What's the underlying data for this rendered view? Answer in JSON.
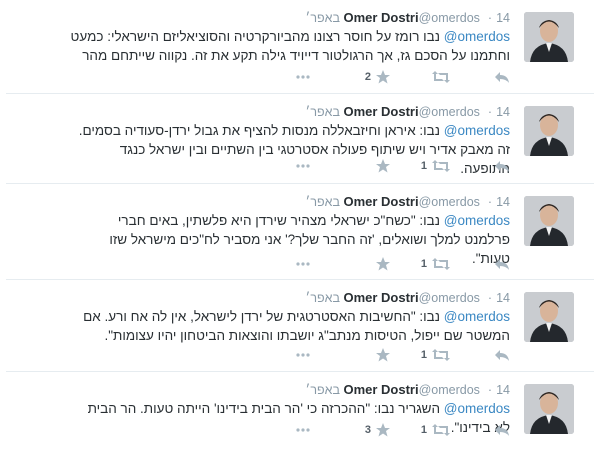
{
  "colors": {
    "mention": "#3b88c3",
    "muted": "#8899a6",
    "text": "#292f33",
    "divider": "#e6ecf0"
  },
  "tweets": [
    {
      "name": "Omer Dostri",
      "handle": "@omerdos",
      "date": "14 באפר׳",
      "mention": "@omerdos",
      "text": " נבו רומז על חוסר רצונו מהביורקרטיה והסוציאליזם הישראלי: כמעט וחתמנו על הסכם גז, אך הרגולטור דייויד גילה תקע את זה. נקווה שייתחם מהר",
      "reply_count": "",
      "retweet_count": "",
      "favorite_count": "2"
    },
    {
      "name": "Omer Dostri",
      "handle": "@omerdos",
      "date": "14 באפר׳",
      "mention": "@omerdos",
      "text": " נבו: איראן וחיזבאללה מנסות להציף את גבול ירדן-סעודיה בסמים. זה מאבק אדיר ויש שיתוף פעולה אסטרטגי בין השתיים ובין ישראל כנגד התופעה.",
      "reply_count": "",
      "retweet_count": "1",
      "favorite_count": ""
    },
    {
      "name": "Omer Dostri",
      "handle": "@omerdos",
      "date": "14 באפר׳",
      "mention": "@omerdos",
      "text": " נבו: \"כשח\"כ ישראלי מצהיר שירדן היא פלשתין, באים חברי פרלמנט למלך ושואלים, 'זה החבר שלך?' אני מסביר לח\"כים מישראל שזו טעות\".",
      "reply_count": "",
      "retweet_count": "1",
      "favorite_count": ""
    },
    {
      "name": "Omer Dostri",
      "handle": "@omerdos",
      "date": "14 באפר׳",
      "mention": "@omerdos",
      "text": " נבו: \"החשיבות האסטרטגית של ירדן לישראל, אין לה אח ורע. אם המשטר שם ייפול, הטיסות מנתב\"ג יושבתו והוצאות הביטחון יהיו עצומות\".",
      "reply_count": "",
      "retweet_count": "1",
      "favorite_count": ""
    },
    {
      "name": "Omer Dostri",
      "handle": "@omerdos",
      "date": "14 באפר׳",
      "mention": "@omerdos",
      "text": " השגריר נבו: \"ההכרזה כי 'הר הבית בידינו' הייתה טעות. הר הבית לא בידינו\".",
      "reply_count": "",
      "retweet_count": "1",
      "favorite_count": "3"
    }
  ]
}
